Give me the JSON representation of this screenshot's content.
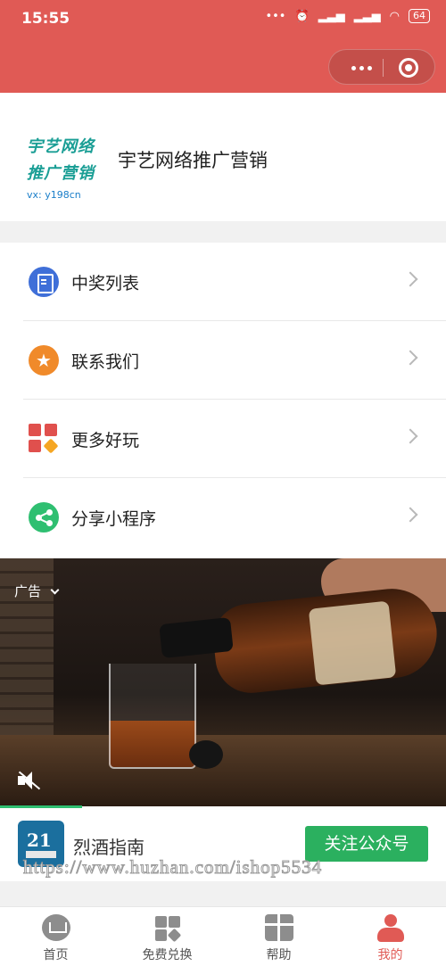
{
  "status_bar": {
    "time": "15:55",
    "battery": "64"
  },
  "profile": {
    "logo_line1": "宇艺网络",
    "logo_line2": "推广营销",
    "logo_line3": "vx: y198cn",
    "name": "宇艺网络推广营销"
  },
  "menu": {
    "items": [
      {
        "label": "中奖列表",
        "icon": "clipboard-list-icon",
        "color": "#3f6fd8"
      },
      {
        "label": "联系我们",
        "icon": "star-icon",
        "color": "#f08a2a"
      },
      {
        "label": "更多好玩",
        "icon": "apps-grid-icon",
        "color": "#e0504d"
      },
      {
        "label": "分享小程序",
        "icon": "share-icon",
        "color": "#2fbf71"
      }
    ]
  },
  "ad": {
    "tag": "广告",
    "advertiser": "烈酒指南",
    "cta": "关注公众号",
    "watermark": "https://www.huzhan.com/ishop5534"
  },
  "tabbar": {
    "tabs": [
      {
        "label": "首页",
        "icon": "home-crown-icon",
        "active": false
      },
      {
        "label": "免费兑换",
        "icon": "exchange-grid-icon",
        "active": false
      },
      {
        "label": "帮助",
        "icon": "gift-icon",
        "active": false
      },
      {
        "label": "我的",
        "icon": "user-icon",
        "active": true
      }
    ]
  },
  "colors": {
    "header": "#e05a55",
    "accent_green": "#2bb05f"
  }
}
